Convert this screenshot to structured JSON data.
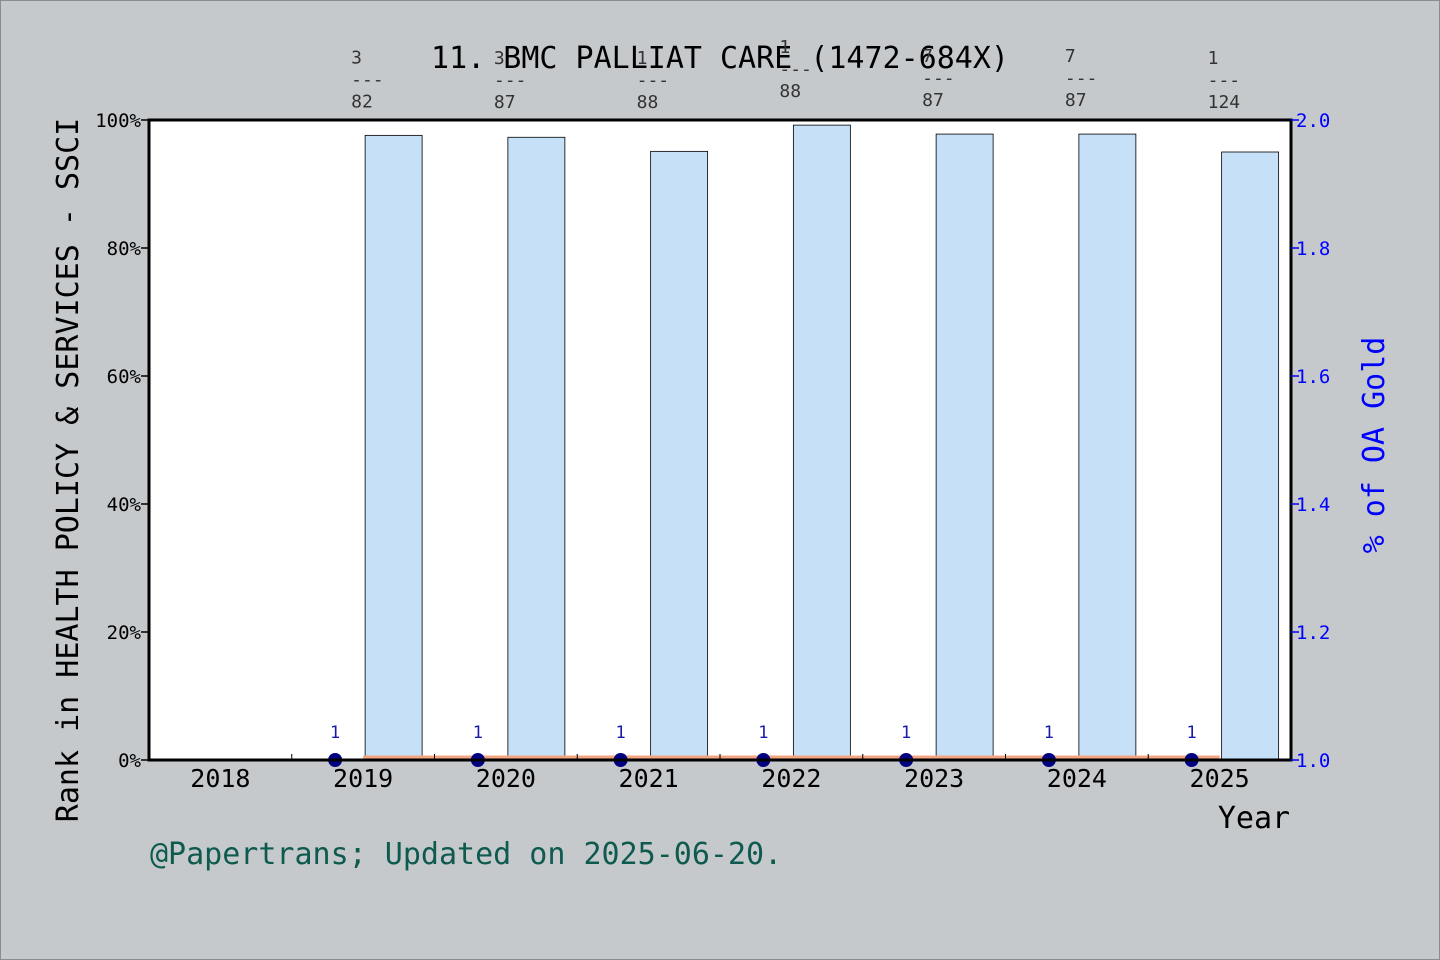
{
  "chart_data": {
    "type": "bar",
    "title": "11. BMC PALLIAT CARE (1472-684X)",
    "xlabel": "Year",
    "ylabel": "Rank in HEALTH POLICY & SERVICES - SSCI",
    "ylabel_right": "% of OA Gold",
    "categories": [
      "2018",
      "2019",
      "2020",
      "2021",
      "2022",
      "2023",
      "2024",
      "2025"
    ],
    "left_axis": {
      "range": [
        0,
        100
      ],
      "ticks": [
        "0%",
        "20%",
        "40%",
        "60%",
        "80%",
        "100%"
      ]
    },
    "right_axis": {
      "range": [
        1.0,
        2.0
      ],
      "ticks": [
        "1.0",
        "1.2",
        "1.4",
        "1.6",
        "1.8",
        "2.0"
      ]
    },
    "series": [
      {
        "type": "bar",
        "color": "#c6e0f7",
        "values": [
          null,
          97.6,
          97.3,
          95.1,
          99.2,
          97.8,
          97.8,
          95.0
        ]
      },
      {
        "type": "line",
        "axis": "right",
        "color": "#000080",
        "values": [
          null,
          1.0,
          1.0,
          1.0,
          1.0,
          1.0,
          1.0,
          1.0
        ],
        "point_labels": [
          "",
          "1",
          "1",
          "1",
          "1",
          "1",
          "1",
          "1"
        ]
      },
      {
        "type": "line",
        "axis": "left",
        "color": "#f4a582",
        "values": [
          null,
          0.4,
          0.4,
          0.4,
          0.4,
          0.4,
          0.4,
          0.4
        ]
      }
    ],
    "rank_annotations": [
      {
        "year": "2019",
        "rank": "3",
        "sep": "---",
        "total": "82"
      },
      {
        "year": "2020",
        "rank": "3",
        "sep": "---",
        "total": "87"
      },
      {
        "year": "2021",
        "rank": "1",
        "sep": "---",
        "total": "88"
      },
      {
        "year": "2022",
        "rank": "1",
        "sep": "---",
        "total": "88"
      },
      {
        "year": "2023",
        "rank": "7",
        "sep": "---",
        "total": "87"
      },
      {
        "year": "2024",
        "rank": "7",
        "sep": "---",
        "total": "87"
      },
      {
        "year": "2025",
        "rank": "1",
        "sep": "---",
        "total": "124"
      }
    ],
    "grid": false,
    "legend": "none"
  },
  "footer": "@Papertrans; Updated on 2025-06-20."
}
